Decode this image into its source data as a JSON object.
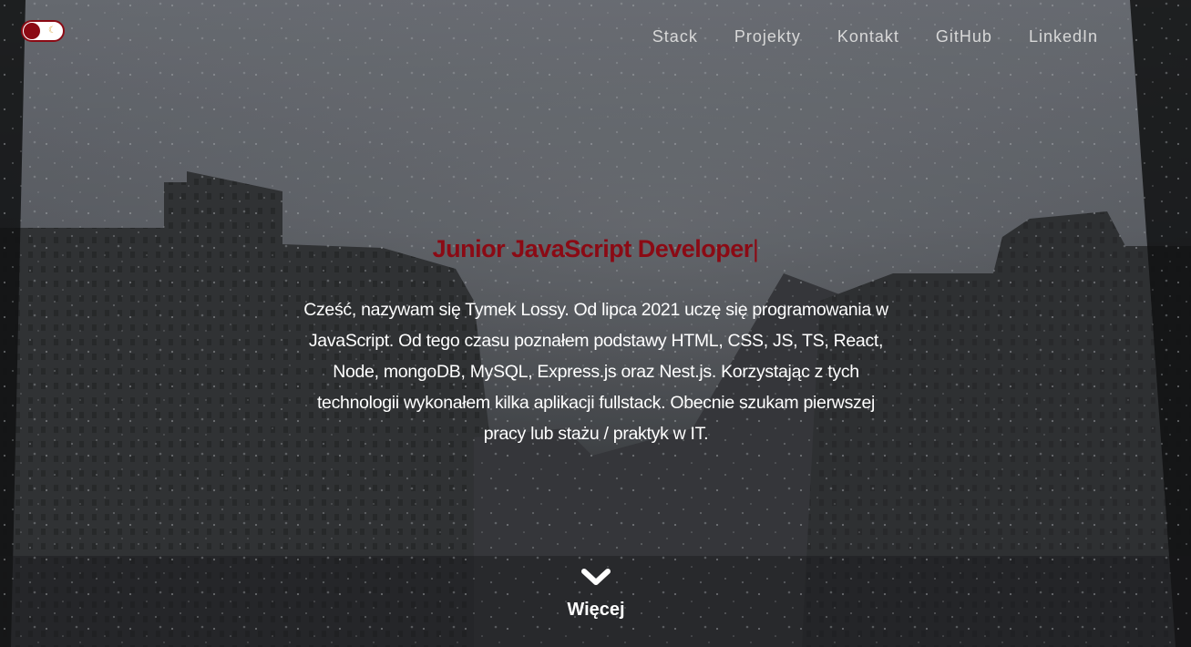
{
  "theme_toggle": {
    "icon": "moon-icon",
    "knob_color": "#8b0a14"
  },
  "nav": {
    "items": [
      {
        "label": "Stack"
      },
      {
        "label": "Projekty"
      },
      {
        "label": "Kontakt"
      },
      {
        "label": "GitHub"
      },
      {
        "label": "LinkedIn"
      }
    ]
  },
  "hero": {
    "headline": "Junior JavaScript Developer",
    "cursor": "|",
    "intro": "Cześć, nazywam się Tymek Lossy. Od lipca 2021 uczę się programowania w JavaScript. Od tego czasu poznałem podstawy HTML, CSS, JS, TS, React, Node, mongoDB, MySQL, Express.js oraz Nest.js. Korzystając z tych technologii wykonałem kilka aplikacji fullstack. Obecnie szukam pierwszej pracy lub stażu / praktyk w IT.",
    "more_label": "Więcej",
    "more_icon": "chevron-down-icon"
  },
  "colors": {
    "accent": "#8b0a14",
    "text": "#ffffff",
    "nav_text": "#d8d8d8"
  }
}
